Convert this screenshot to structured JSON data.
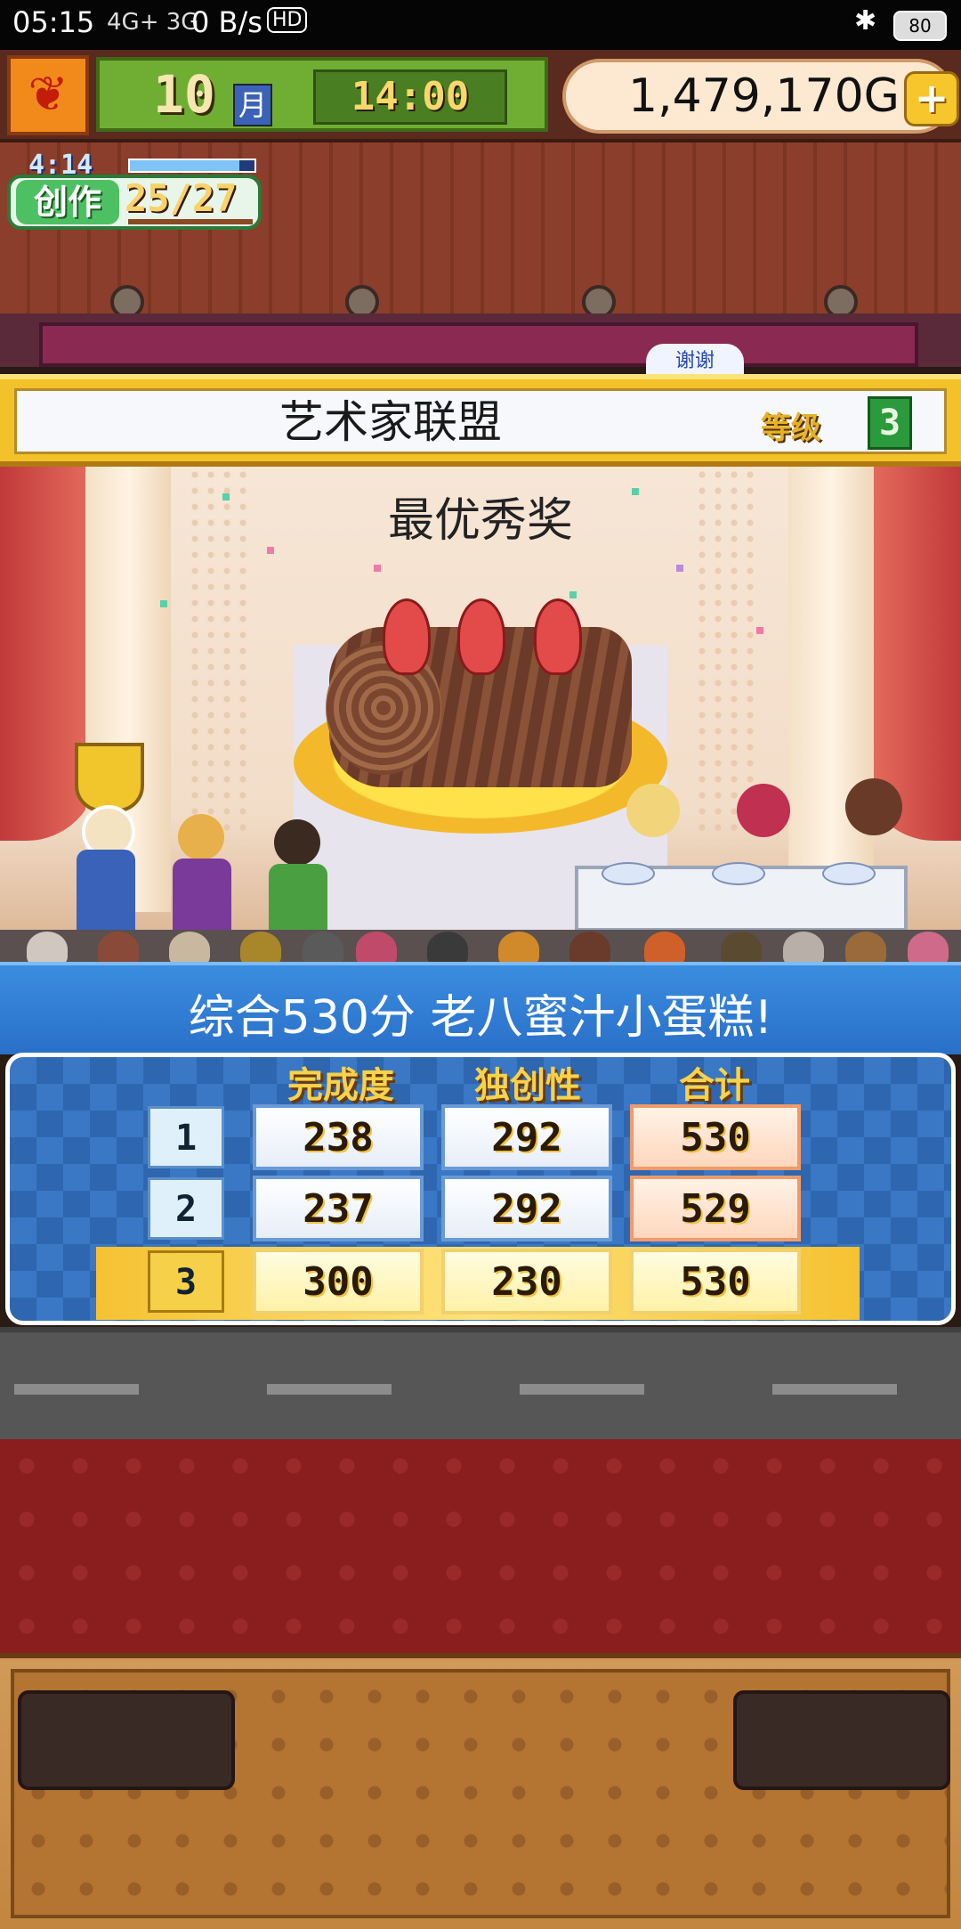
{
  "status_bar": {
    "time": "05:15",
    "network": "4G+ 3G",
    "speed": "0 B/s",
    "hd": "HD",
    "battery": "80"
  },
  "hud": {
    "month_number": "10",
    "month_label": "月",
    "clock": "14:00",
    "money": "1,479,170",
    "currency": "G",
    "plus_label": "+"
  },
  "create_badge": {
    "timer": "4:14",
    "label": "创作",
    "progress": "25/27",
    "progress_fraction": 0.93
  },
  "event": {
    "sign_peek": "谢谢",
    "title": "艺术家联盟",
    "level_label": "等级",
    "level_value": "3"
  },
  "award": {
    "title": "最优秀奖"
  },
  "result": {
    "text": "综合530分 老八蜜汁小蛋糕!"
  },
  "scoreboard": {
    "headers": [
      "完成度",
      "独创性",
      "合计"
    ],
    "rows": [
      {
        "rank": "1",
        "completion": "238",
        "originality": "292",
        "total": "530",
        "highlight": false
      },
      {
        "rank": "2",
        "completion": "237",
        "originality": "292",
        "total": "529",
        "highlight": false
      },
      {
        "rank": "3",
        "completion": "300",
        "originality": "230",
        "total": "530",
        "highlight": true
      }
    ]
  },
  "colors": {
    "hud_green": "#6fae33",
    "banner_gold": "#f3c12a",
    "result_blue": "#2a6fc8",
    "carpet_red": "#8a1e1e"
  }
}
